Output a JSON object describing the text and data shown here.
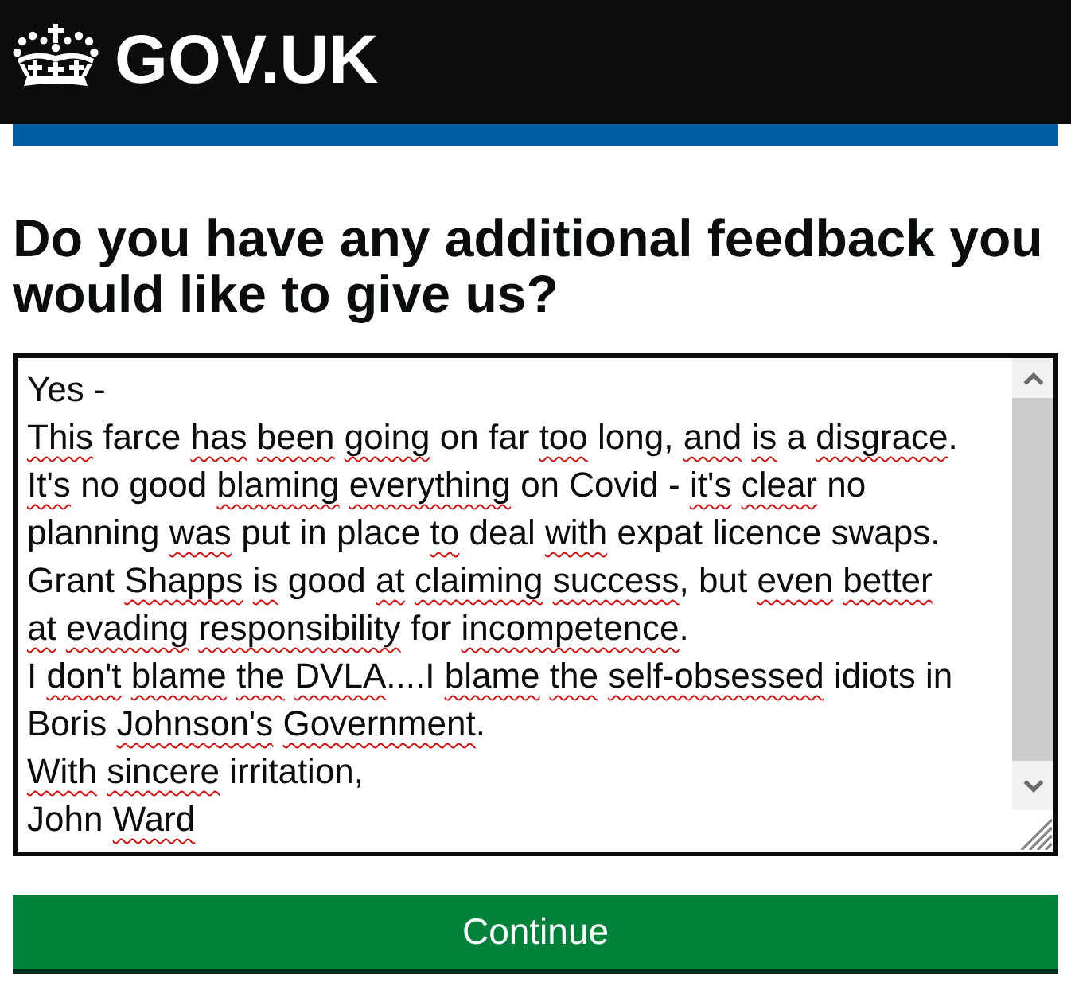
{
  "header": {
    "logo_text": "GOV.UK"
  },
  "question": {
    "heading": "Do you have any additional feedback you would like to give us?"
  },
  "feedback_field": {
    "lines": [
      [
        {
          "text": "Yes",
          "flagged": false
        },
        {
          "text": "-",
          "flagged": false
        }
      ],
      [
        {
          "text": "This",
          "flagged": true
        },
        {
          "text": "farce",
          "flagged": false
        },
        {
          "text": "has",
          "flagged": true
        },
        {
          "text": "been",
          "flagged": true
        },
        {
          "text": "going",
          "flagged": true
        },
        {
          "text": "on",
          "flagged": false
        },
        {
          "text": "far",
          "flagged": false
        },
        {
          "text": "too",
          "flagged": true
        },
        {
          "text": "long,",
          "flagged": false
        },
        {
          "text": "and",
          "flagged": true
        },
        {
          "text": "is",
          "flagged": true
        },
        {
          "text": "a",
          "flagged": false
        },
        {
          "text": "disgrace",
          "flagged": true,
          "suffix": "."
        }
      ],
      [
        {
          "text": "It's",
          "flagged": true
        },
        {
          "text": "no",
          "flagged": false
        },
        {
          "text": "good",
          "flagged": false
        },
        {
          "text": "blaming",
          "flagged": true
        },
        {
          "text": "everything",
          "flagged": true
        },
        {
          "text": "on",
          "flagged": false
        },
        {
          "text": "Covid",
          "flagged": false
        },
        {
          "text": "-",
          "flagged": false
        },
        {
          "text": "it's",
          "flagged": true
        },
        {
          "text": "clear",
          "flagged": true
        },
        {
          "text": "no",
          "flagged": false
        }
      ],
      [
        {
          "text": "planning",
          "flagged": false
        },
        {
          "text": "was",
          "flagged": true
        },
        {
          "text": "put",
          "flagged": false
        },
        {
          "text": "in",
          "flagged": false
        },
        {
          "text": "place",
          "flagged": false
        },
        {
          "text": "to",
          "flagged": true
        },
        {
          "text": "deal",
          "flagged": false
        },
        {
          "text": "with",
          "flagged": true
        },
        {
          "text": "expat",
          "flagged": false
        },
        {
          "text": "licence",
          "flagged": false
        },
        {
          "text": "swaps.",
          "flagged": false
        }
      ],
      [
        {
          "text": "Grant",
          "flagged": false
        },
        {
          "text": "Shapps",
          "flagged": true
        },
        {
          "text": "is",
          "flagged": true
        },
        {
          "text": "good",
          "flagged": false
        },
        {
          "text": "at",
          "flagged": true
        },
        {
          "text": "claiming",
          "flagged": true
        },
        {
          "text": "success",
          "flagged": true,
          "suffix": ","
        },
        {
          "text": "but",
          "flagged": false
        },
        {
          "text": "even",
          "flagged": true
        },
        {
          "text": "better",
          "flagged": true
        }
      ],
      [
        {
          "text": "at",
          "flagged": true
        },
        {
          "text": "evading",
          "flagged": true
        },
        {
          "text": "responsibility",
          "flagged": true
        },
        {
          "text": "for",
          "flagged": false
        },
        {
          "text": "incompetence",
          "flagged": true,
          "suffix": "."
        }
      ],
      [
        {
          "text": "I",
          "flagged": false
        },
        {
          "text": "don't",
          "flagged": true
        },
        {
          "text": "blame",
          "flagged": true
        },
        {
          "text": "the",
          "flagged": true
        },
        {
          "text": "DVLA",
          "flagged": true,
          "suffix": "....I"
        },
        {
          "text": "blame",
          "flagged": true
        },
        {
          "text": "the",
          "flagged": true
        },
        {
          "text": "self-obsessed",
          "flagged": true
        },
        {
          "text": "idiots",
          "flagged": false
        },
        {
          "text": "in",
          "flagged": false
        }
      ],
      [
        {
          "text": "Boris",
          "flagged": false
        },
        {
          "text": "Johnson's",
          "flagged": true
        },
        {
          "text": "Government",
          "flagged": true,
          "suffix": "."
        }
      ],
      [
        {
          "text": "With",
          "flagged": true
        },
        {
          "text": "sincere",
          "flagged": true
        },
        {
          "text": "irritation,",
          "flagged": false
        }
      ],
      [
        {
          "text": "John",
          "flagged": false
        },
        {
          "text": "Ward",
          "flagged": true
        }
      ]
    ]
  },
  "continue_button": {
    "label": "Continue"
  }
}
